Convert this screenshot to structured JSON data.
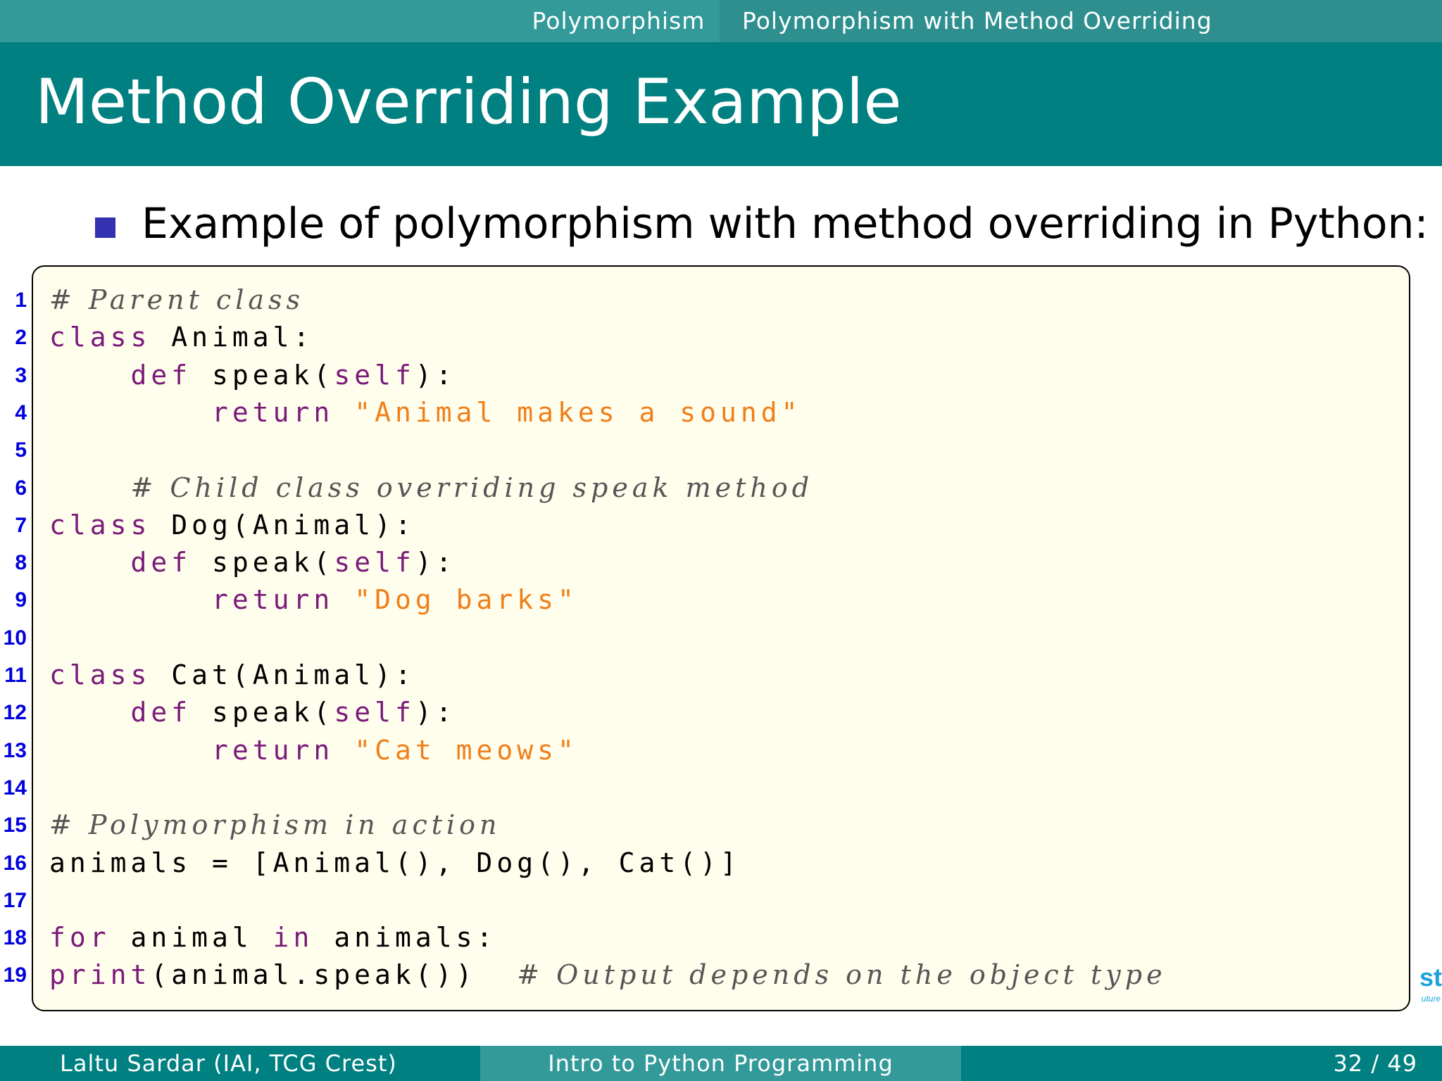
{
  "nav": {
    "section": "Polymorphism",
    "subsection": "Polymorphism with Method Overriding"
  },
  "title": "Method Overriding Example",
  "bullet": "Example of polymorphism with method overriding in Python:",
  "code_lines": [
    {
      "num": "1",
      "tokens": [
        {
          "t": "cm",
          "v": "# Parent class"
        }
      ]
    },
    {
      "num": "2",
      "tokens": [
        {
          "t": "kw",
          "v": "class"
        },
        {
          "t": "n",
          "v": " Animal:"
        }
      ]
    },
    {
      "num": "3",
      "tokens": [
        {
          "t": "n",
          "v": "    "
        },
        {
          "t": "kw",
          "v": "def"
        },
        {
          "t": "n",
          "v": " speak("
        },
        {
          "t": "kw",
          "v": "self"
        },
        {
          "t": "n",
          "v": "):"
        }
      ]
    },
    {
      "num": "4",
      "tokens": [
        {
          "t": "n",
          "v": "        "
        },
        {
          "t": "kw",
          "v": "return"
        },
        {
          "t": "n",
          "v": " "
        },
        {
          "t": "str",
          "v": "\"Animal makes a sound\""
        }
      ]
    },
    {
      "num": "5",
      "tokens": []
    },
    {
      "num": "6",
      "tokens": [
        {
          "t": "n",
          "v": "    "
        },
        {
          "t": "cm",
          "v": "# Child class overriding speak method"
        }
      ]
    },
    {
      "num": "7",
      "tokens": [
        {
          "t": "kw",
          "v": "class"
        },
        {
          "t": "n",
          "v": " Dog(Animal):"
        }
      ]
    },
    {
      "num": "8",
      "tokens": [
        {
          "t": "n",
          "v": "    "
        },
        {
          "t": "kw",
          "v": "def"
        },
        {
          "t": "n",
          "v": " speak("
        },
        {
          "t": "kw",
          "v": "self"
        },
        {
          "t": "n",
          "v": "):"
        }
      ]
    },
    {
      "num": "9",
      "tokens": [
        {
          "t": "n",
          "v": "        "
        },
        {
          "t": "kw",
          "v": "return"
        },
        {
          "t": "n",
          "v": " "
        },
        {
          "t": "str",
          "v": "\"Dog barks\""
        }
      ]
    },
    {
      "num": "10",
      "tokens": []
    },
    {
      "num": "11",
      "tokens": [
        {
          "t": "kw",
          "v": "class"
        },
        {
          "t": "n",
          "v": " Cat(Animal):"
        }
      ]
    },
    {
      "num": "12",
      "tokens": [
        {
          "t": "n",
          "v": "    "
        },
        {
          "t": "kw",
          "v": "def"
        },
        {
          "t": "n",
          "v": " speak("
        },
        {
          "t": "kw",
          "v": "self"
        },
        {
          "t": "n",
          "v": "):"
        }
      ]
    },
    {
      "num": "13",
      "tokens": [
        {
          "t": "n",
          "v": "        "
        },
        {
          "t": "kw",
          "v": "return"
        },
        {
          "t": "n",
          "v": " "
        },
        {
          "t": "str",
          "v": "\"Cat meows\""
        }
      ]
    },
    {
      "num": "14",
      "tokens": []
    },
    {
      "num": "15",
      "tokens": [
        {
          "t": "cm",
          "v": "# Polymorphism in action"
        }
      ]
    },
    {
      "num": "16",
      "tokens": [
        {
          "t": "n",
          "v": "animals = [Animal(), Dog(), Cat()]"
        }
      ]
    },
    {
      "num": "17",
      "tokens": []
    },
    {
      "num": "18",
      "tokens": [
        {
          "t": "kw",
          "v": "for"
        },
        {
          "t": "n",
          "v": " animal "
        },
        {
          "t": "kw",
          "v": "in"
        },
        {
          "t": "n",
          "v": " animals:"
        }
      ]
    },
    {
      "num": "19",
      "tokens": [
        {
          "t": "kw",
          "v": "print"
        },
        {
          "t": "n",
          "v": "(animal.speak())  "
        },
        {
          "t": "cm",
          "v": "# Output depends on the object type"
        }
      ]
    }
  ],
  "logo": {
    "text": "st",
    "subtext": "uture"
  },
  "footer": {
    "author": "Laltu Sardar (IAI, TCG Crest)",
    "course": "Intro to Python Programming",
    "page": "32 / 49"
  },
  "colors": {
    "teal": "#008080",
    "teal_light": "#339999",
    "bullet": "#3333b2",
    "keyword": "#7a1a7a",
    "string": "#ef7f1a",
    "comment": "#555555",
    "line_number": "#0000dd",
    "code_bg": "#fffdec"
  }
}
